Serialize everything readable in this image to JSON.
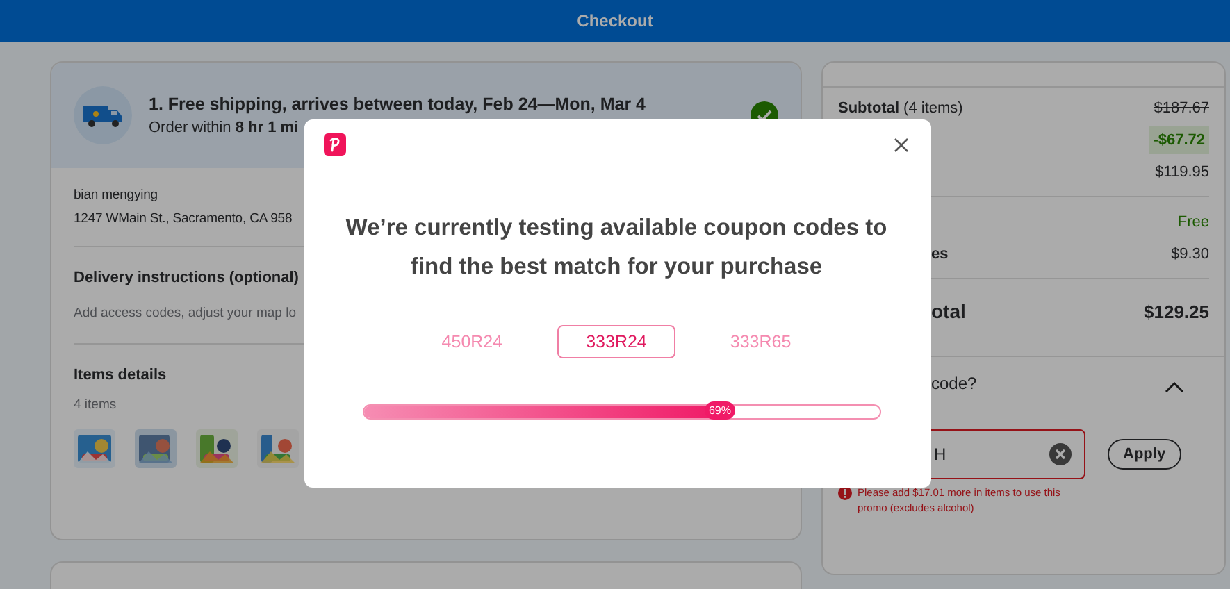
{
  "header": {
    "title": "Checkout"
  },
  "shipping": {
    "title": "1. Free shipping, arrives between today, Feb 24—Mon, Mar 4",
    "subtitle": "Order within **8 hr 1 mi**",
    "complete": true
  },
  "address": {
    "name": "bian mengying",
    "line": "1247 WMain St., Sacramento, CA 958"
  },
  "delivery": {
    "title": "Delivery instructions (optional)",
    "hint": "Add access codes, adjust your map lo"
  },
  "items": {
    "title": "Items details",
    "count": "4 items"
  },
  "summary": {
    "rows": [
      {
        "label": "Subtotal",
        "note": "(4 items)",
        "value": "$187.67",
        "kind": "strike"
      },
      {
        "value": "-$67.72",
        "kind": "savings"
      },
      {
        "value": "$119.95",
        "kind": "plain"
      },
      {
        "kind": "divider"
      },
      {
        "value": "Free",
        "kind": "free"
      },
      {
        "label": "es",
        "value": "$9.30",
        "kind": "plain"
      },
      {
        "kind": "divider"
      },
      {
        "label": "otal",
        "value": "$129.25",
        "kind": "total"
      }
    ]
  },
  "promo": {
    "label": "code?",
    "expanded": true,
    "value": "H",
    "error": "Please add $17.01 more in items to use this promo (excludes alcohol)",
    "apply": "Apply"
  },
  "modal": {
    "message": "We’re currently testing available coupon codes to find the best match for your purchase",
    "codes": [
      {
        "code": "450R24",
        "selected": false
      },
      {
        "code": "333R24",
        "selected": true
      },
      {
        "code": "333R65",
        "selected": false
      }
    ],
    "progress": {
      "level": 0.69,
      "label": "69%"
    }
  }
}
